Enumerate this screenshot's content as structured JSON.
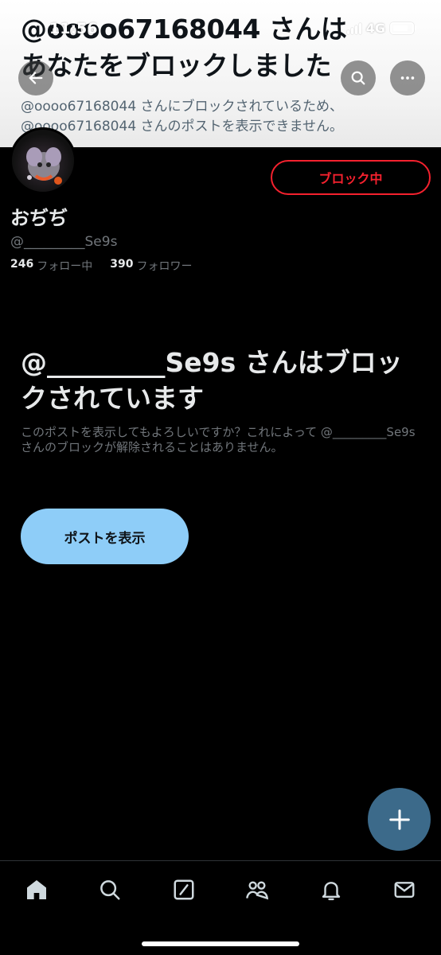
{
  "status_bar": {
    "time": "11:56",
    "network": "4G"
  },
  "banner": {
    "title": "@oooo67168044 さんは\nあなたをブロックしました",
    "subtitle": "@oooo67168044 さんにブロックされているため、\n@oooo67168044 さんのポストを表示できません。"
  },
  "profile": {
    "display_name": "おぢぢ",
    "handle": "@_________Se9s",
    "following_count": "246",
    "following_label": "フォロー中",
    "followers_count": "390",
    "followers_label": "フォロワー",
    "block_button_label": "ブロック中"
  },
  "notice": {
    "title": "@_________Se9s さんはブロックされています",
    "body": "このポストを表示してもよろしいですか？これによって @_________Se9s さんのブロックが解除されることはありません。",
    "view_posts_label": "ポストを表示"
  },
  "colors": {
    "accent_red": "#f4212e",
    "button_blue": "#8ecdf8",
    "fab": "#3c6a8a"
  },
  "icons": {
    "back": "arrow-left-icon",
    "search": "search-icon",
    "more": "more-icon",
    "compose": "plus-icon",
    "tabs": [
      "home-icon",
      "search-icon",
      "grok-icon",
      "communities-icon",
      "notifications-icon",
      "messages-icon"
    ]
  }
}
